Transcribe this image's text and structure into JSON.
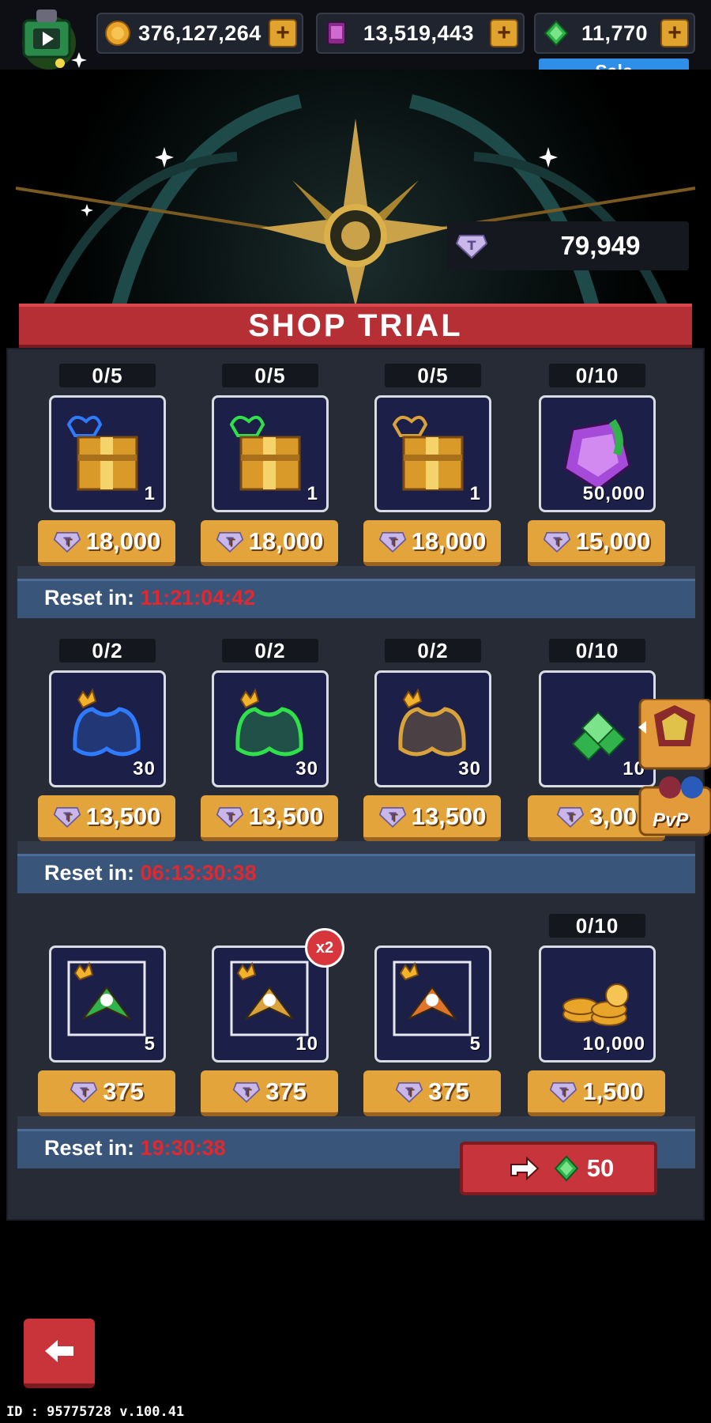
{
  "top_bar": {
    "gold": "376,127,264",
    "crystal": "13,519,443",
    "gems": "11,770",
    "sale_label": "Sale"
  },
  "trial_points": "79,949",
  "banner_title": "SHOP TRIAL",
  "sections": [
    {
      "reset_label": "Reset in:",
      "reset_timer": "11:21:04:42",
      "items": [
        {
          "count": "0/5",
          "qty": "1",
          "price": "18,000",
          "icon": "blue-ship-chest-icon"
        },
        {
          "count": "0/5",
          "qty": "1",
          "price": "18,000",
          "icon": "green-ship-chest-icon"
        },
        {
          "count": "0/5",
          "qty": "1",
          "price": "18,000",
          "icon": "gold-ship-chest-icon"
        },
        {
          "count": "0/10",
          "qty": "50,000",
          "price": "15,000",
          "icon": "purple-gem-pack-icon"
        }
      ]
    },
    {
      "reset_label": "Reset in:",
      "reset_timer": "06:13:30:38",
      "items": [
        {
          "count": "0/2",
          "qty": "30",
          "price": "13,500",
          "icon": "blue-ship-shard-icon"
        },
        {
          "count": "0/2",
          "qty": "30",
          "price": "13,500",
          "icon": "green-ship-shard-icon"
        },
        {
          "count": "0/2",
          "qty": "30",
          "price": "13,500",
          "icon": "gold-ship-shard-icon"
        },
        {
          "count": "0/10",
          "qty": "10",
          "price": "3,00",
          "icon": "emerald-pile-icon"
        }
      ]
    },
    {
      "reset_label": "Reset in:",
      "reset_timer": "19:30:38",
      "items": [
        {
          "count": "",
          "qty": "5",
          "price": "375",
          "icon": "green-drone-card-icon"
        },
        {
          "count": "",
          "qty": "10",
          "price": "375",
          "icon": "golden-drone-card-icon",
          "badge": "x2"
        },
        {
          "count": "",
          "qty": "5",
          "price": "375",
          "icon": "fire-wing-card-icon"
        },
        {
          "count": "0/10",
          "qty": "10,000",
          "price": "1,500",
          "icon": "gold-coin-pile-icon"
        }
      ]
    }
  ],
  "refresh_cost": "50",
  "pvp_label": "PvP",
  "footer_text": "ID : 95775728 v.100.41",
  "colors": {
    "banner": "#b52f35",
    "price_button": "#e3a43b",
    "timer": "#e1282f",
    "panel": "#262b36"
  }
}
